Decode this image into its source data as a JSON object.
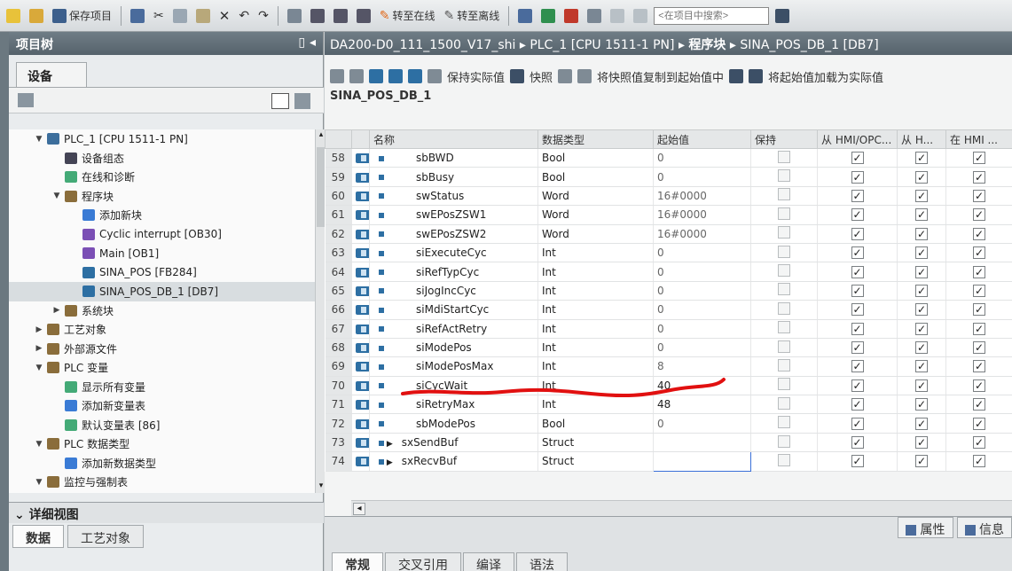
{
  "toolbar": {
    "save_project": "保存项目",
    "go_online": "转至在线",
    "go_offline": "转至离线",
    "search_placeholder": "<在项目中搜索>"
  },
  "project_tree": {
    "title": "项目树",
    "devices_tab": "设备",
    "items": [
      {
        "label": "PLC_1 [CPU 1511-1 PN]",
        "level": 0,
        "expanded": true,
        "color": "#3c6e9c"
      },
      {
        "label": "设备组态",
        "level": 1,
        "color": "#445"
      },
      {
        "label": "在线和诊断",
        "level": 1,
        "color": "#4a7"
      },
      {
        "label": "程序块",
        "level": 1,
        "expanded": true,
        "color": "#8a6d3b"
      },
      {
        "label": "添加新块",
        "level": 2,
        "color": "#3a7bd5"
      },
      {
        "label": "Cyclic interrupt [OB30]",
        "level": 2,
        "color": "#7b4fb5"
      },
      {
        "label": "Main [OB1]",
        "level": 2,
        "color": "#7b4fb5"
      },
      {
        "label": "SINA_POS [FB284]",
        "level": 2,
        "color": "#2d6fa3"
      },
      {
        "label": "SINA_POS_DB_1 [DB7]",
        "level": 2,
        "color": "#2d6fa3",
        "selected": true
      },
      {
        "label": "系统块",
        "level": 1,
        "collapsed": true,
        "color": "#8a6d3b"
      },
      {
        "label": "工艺对象",
        "level": 0,
        "collapsed": true,
        "color": "#8a6d3b"
      },
      {
        "label": "外部源文件",
        "level": 0,
        "collapsed": true,
        "color": "#8a6d3b"
      },
      {
        "label": "PLC 变量",
        "level": 0,
        "expanded": true,
        "color": "#8a6d3b"
      },
      {
        "label": "显示所有变量",
        "level": 1,
        "color": "#4a7"
      },
      {
        "label": "添加新变量表",
        "level": 1,
        "color": "#3a7bd5"
      },
      {
        "label": "默认变量表 [86]",
        "level": 1,
        "color": "#4a7"
      },
      {
        "label": "PLC 数据类型",
        "level": 0,
        "expanded": true,
        "color": "#8a6d3b"
      },
      {
        "label": "添加新数据类型",
        "level": 1,
        "color": "#3a7bd5"
      },
      {
        "label": "监控与强制表",
        "level": 0,
        "expanded": true,
        "color": "#8a6d3b"
      }
    ],
    "detail_view": "详细视图",
    "detail_tabs": [
      "数据",
      "工艺对象"
    ]
  },
  "editor": {
    "breadcrumb": {
      "project": "DA200-D0_111_1500_V17_shi",
      "plc": "PLC_1 [CPU 1511-1 PN]",
      "folder": "程序块",
      "block": "SINA_POS_DB_1 [DB7]",
      "sep": "▸"
    },
    "toolbar": {
      "keep_actual": "保持实际值",
      "snapshot": "快照",
      "copy_snapshot": "将快照值复制到起始值中",
      "load_start": "将起始值加载为实际值"
    },
    "block_name": "SINA_POS_DB_1",
    "columns": [
      "名称",
      "数据类型",
      "起始值",
      "保持",
      "从 HMI/OPC...",
      "从 H...",
      "在 HMI ..."
    ],
    "rows": [
      {
        "num": "58",
        "name": "sbBWD",
        "type": "Bool",
        "start": "0",
        "expand": false
      },
      {
        "num": "59",
        "name": "sbBusy",
        "type": "Bool",
        "start": "0",
        "expand": false
      },
      {
        "num": "60",
        "name": "swStatus",
        "type": "Word",
        "start": "16#0000",
        "expand": false
      },
      {
        "num": "61",
        "name": "swEPosZSW1",
        "type": "Word",
        "start": "16#0000",
        "expand": false
      },
      {
        "num": "62",
        "name": "swEPosZSW2",
        "type": "Word",
        "start": "16#0000",
        "expand": false
      },
      {
        "num": "63",
        "name": "siExecuteCyc",
        "type": "Int",
        "start": "0",
        "expand": false
      },
      {
        "num": "64",
        "name": "siRefTypCyc",
        "type": "Int",
        "start": "0",
        "expand": false
      },
      {
        "num": "65",
        "name": "siJogIncCyc",
        "type": "Int",
        "start": "0",
        "expand": false
      },
      {
        "num": "66",
        "name": "siMdiStartCyc",
        "type": "Int",
        "start": "0",
        "expand": false
      },
      {
        "num": "67",
        "name": "siRefActRetry",
        "type": "Int",
        "start": "0",
        "expand": false
      },
      {
        "num": "68",
        "name": "siModePos",
        "type": "Int",
        "start": "0",
        "expand": false
      },
      {
        "num": "69",
        "name": "siModePosMax",
        "type": "Int",
        "start": "8",
        "expand": false
      },
      {
        "num": "70",
        "name": "siCycWait",
        "type": "Int",
        "start": "40",
        "expand": false,
        "strong": true
      },
      {
        "num": "71",
        "name": "siRetryMax",
        "type": "Int",
        "start": "48",
        "expand": false,
        "strong": true
      },
      {
        "num": "72",
        "name": "sbModePos",
        "type": "Bool",
        "start": "0",
        "expand": false
      },
      {
        "num": "73",
        "name": "sxSendBuf",
        "type": "Struct",
        "start": "",
        "expand": true
      },
      {
        "num": "74",
        "name": "sxRecvBuf",
        "type": "Struct",
        "start": "",
        "expand": true,
        "editing": true
      }
    ],
    "inspector_tabs": [
      "属性",
      "信息"
    ],
    "bottom_tabs": [
      "常规",
      "交叉引用",
      "编译",
      "语法"
    ]
  }
}
